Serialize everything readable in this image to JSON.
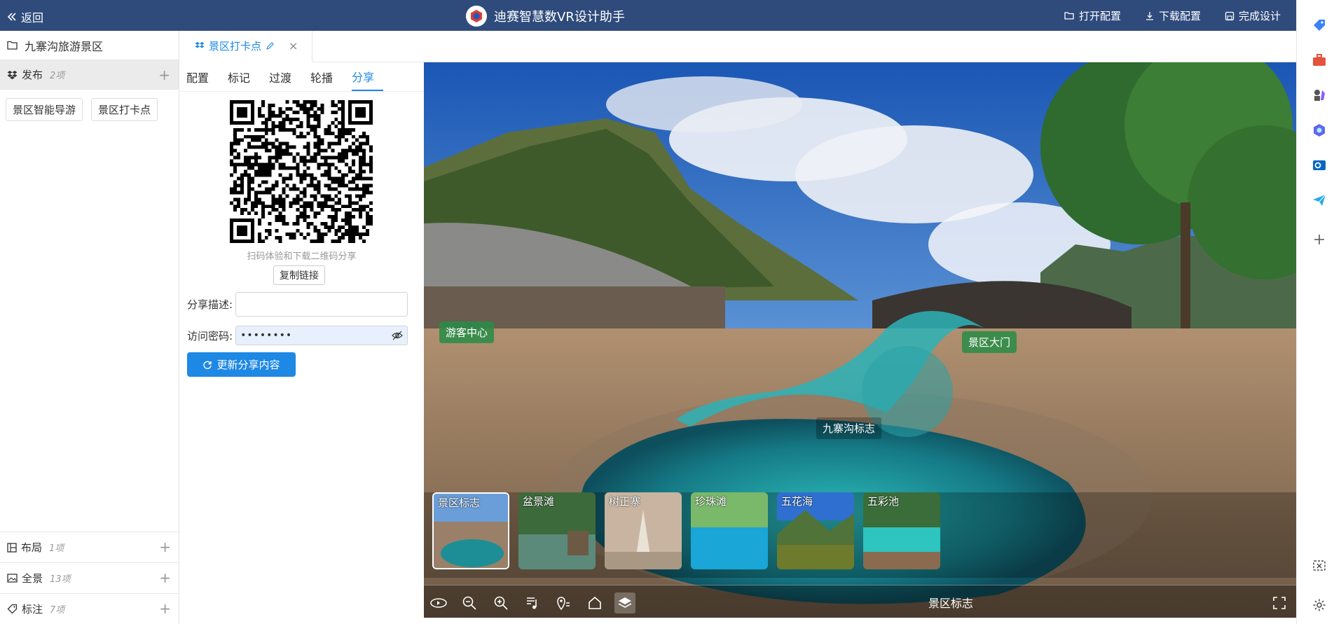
{
  "header": {
    "back_label": "返回",
    "app_title": "迪赛智慧数VR设计助手",
    "open_config": "打开配置",
    "download_config": "下载配置",
    "finish_design": "完成设计",
    "bg_color": "#2f4b7c"
  },
  "sidebar": {
    "project_name": "九寨沟旅游景区",
    "publish": {
      "label": "发布",
      "count": "2项"
    },
    "publish_items": [
      "景区智能导游",
      "景区打卡点"
    ],
    "layout": {
      "label": "布局",
      "count": "1项"
    },
    "panorama": {
      "label": "全景",
      "count": "13项"
    },
    "marker": {
      "label": "标注",
      "count": "7项"
    }
  },
  "doc_tab": {
    "label": "景区打卡点"
  },
  "panel": {
    "tabs": [
      "配置",
      "标记",
      "过渡",
      "轮播",
      "分享"
    ],
    "active_tab": "分享",
    "qr_caption": "扫码体验和下载二维码分享",
    "copy_link": "复制链接",
    "share_desc_label": "分享描述:",
    "share_desc_value": "",
    "password_label": "访问密码:",
    "password_value": "••••••••",
    "update_button": "更新分享内容",
    "accent": "#1e88e5"
  },
  "scene": {
    "hotspots": [
      "游客中心",
      "景区大门",
      "九寨沟标志"
    ],
    "thumbnails": [
      "景区标志",
      "盆景滩",
      "树正寨",
      "珍珠滩",
      "五花海",
      "五彩池"
    ],
    "selected_thumbnail": "景区标志",
    "current_scene": "景区标志"
  },
  "icons": {
    "toolbar": [
      "auto-rotate-icon",
      "zoom-out-icon",
      "zoom-in-icon",
      "music-list-icon",
      "location-list-icon",
      "home-icon",
      "layers-icon",
      "fullscreen-icon"
    ],
    "rightbar": [
      "tag-icon",
      "toolbox-icon",
      "chess-icon",
      "copilot-icon",
      "outlook-icon",
      "send-icon",
      "add-icon",
      "screenshot-icon",
      "settings-icon"
    ]
  }
}
